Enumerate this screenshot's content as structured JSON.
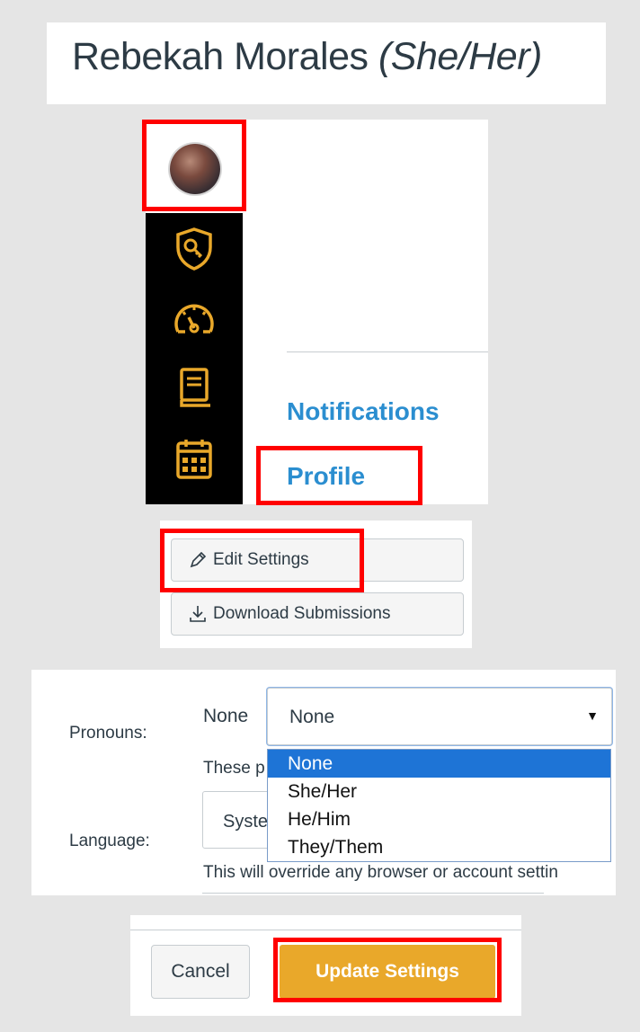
{
  "profile": {
    "name": "Rebekah Morales",
    "pronouns": "(She/Her)"
  },
  "nav": {
    "icons": [
      "avatar",
      "shield-key-icon",
      "dashboard-icon",
      "book-icon",
      "calendar-icon"
    ],
    "links": [
      "Notifications",
      "Profile"
    ]
  },
  "actions": {
    "edit_settings": "Edit Settings",
    "download_submissions": "Download Submissions"
  },
  "form": {
    "pronouns_label": "Pronouns:",
    "pronouns_current": "None",
    "pronouns_selected": "None",
    "options": [
      "None",
      "She/Her",
      "He/Him",
      "They/Them"
    ],
    "pronouns_help_partial": "These p",
    "language_label": "Language:",
    "language_partial": "Syste",
    "language_help": "This will override any browser or account settin"
  },
  "footer": {
    "cancel": "Cancel",
    "update": "Update Settings"
  },
  "colors": {
    "accent": "#e9a82a",
    "link": "#2b8ed0",
    "highlight": "#ff0000",
    "rail": "#000000",
    "selected": "#1e74d6"
  }
}
